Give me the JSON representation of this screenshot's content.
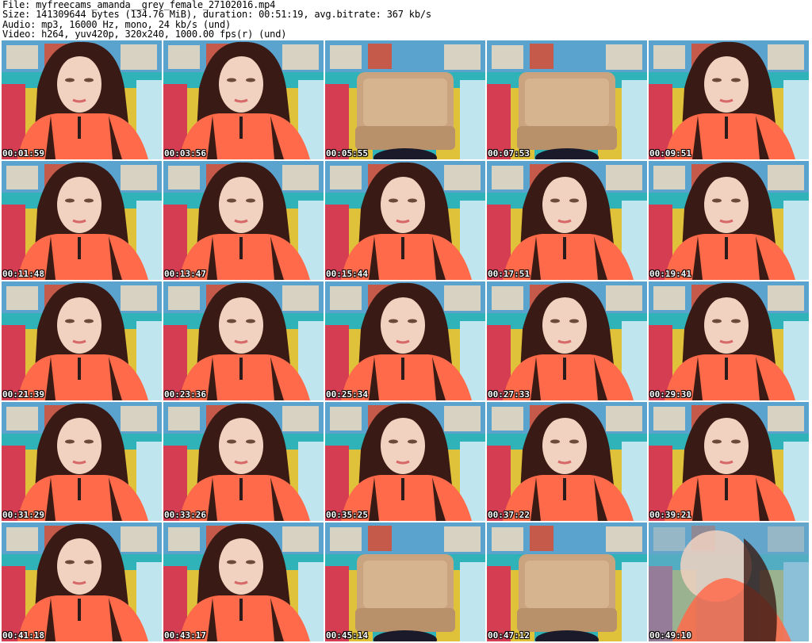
{
  "header": {
    "file": "File: myfreecams_amanda__grey_female_27102016.mp4",
    "size": "Size: 141309644 bytes (134.76 MiB), duration: 00:51:19, avg.bitrate: 367 kb/s",
    "audio": "Audio: mp3, 16000 Hz, mono, 24 kb/s (und)",
    "video": "Video: h264, yuv420p, 320x240, 1000.00 fps(r) (und)"
  },
  "thumbnails": [
    {
      "ts": "00:01:59",
      "scene": "person"
    },
    {
      "ts": "00:03:56",
      "scene": "person"
    },
    {
      "ts": "00:05:55",
      "scene": "empty"
    },
    {
      "ts": "00:07:53",
      "scene": "empty"
    },
    {
      "ts": "00:09:51",
      "scene": "person"
    },
    {
      "ts": "00:11:48",
      "scene": "person"
    },
    {
      "ts": "00:13:47",
      "scene": "person"
    },
    {
      "ts": "00:15:44",
      "scene": "person"
    },
    {
      "ts": "00:17:51",
      "scene": "person"
    },
    {
      "ts": "00:19:41",
      "scene": "person"
    },
    {
      "ts": "00:21:39",
      "scene": "person"
    },
    {
      "ts": "00:23:36",
      "scene": "person"
    },
    {
      "ts": "00:25:34",
      "scene": "person"
    },
    {
      "ts": "00:27:33",
      "scene": "person"
    },
    {
      "ts": "00:29:30",
      "scene": "person"
    },
    {
      "ts": "00:31:29",
      "scene": "person"
    },
    {
      "ts": "00:33:26",
      "scene": "person"
    },
    {
      "ts": "00:35:25",
      "scene": "person"
    },
    {
      "ts": "00:37:22",
      "scene": "person"
    },
    {
      "ts": "00:39:21",
      "scene": "person"
    },
    {
      "ts": "00:41:18",
      "scene": "person"
    },
    {
      "ts": "00:43:17",
      "scene": "person"
    },
    {
      "ts": "00:45:14",
      "scene": "empty"
    },
    {
      "ts": "00:47:12",
      "scene": "empty"
    },
    {
      "ts": "00:49:10",
      "scene": "blurry"
    }
  ],
  "colors": {
    "wall_blue": "#3a8fc0",
    "wall_teal": "#2fb3b8",
    "wall_yellow": "#e0c23a",
    "sofa": "#c9a47e",
    "hair": "#3a1a14",
    "skin": "#f1d1c0",
    "shirt": "#ff6a4a"
  }
}
